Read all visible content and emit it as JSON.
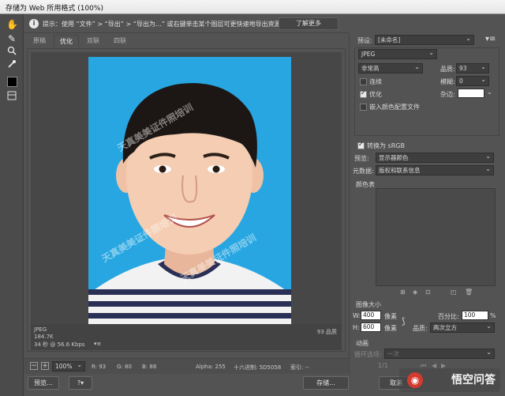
{
  "window": {
    "title": "存储为 Web 所用格式 (100%)"
  },
  "tools": [
    {
      "name": "hand-tool-icon",
      "glyph": "✋"
    },
    {
      "name": "slice-select-tool-icon",
      "glyph": "✎"
    },
    {
      "name": "zoom-tool-icon",
      "glyph": "🔍"
    },
    {
      "name": "eyedropper-tool-icon",
      "glyph": "✒"
    },
    {
      "name": "toggle-slices-icon",
      "glyph": "▤"
    }
  ],
  "tip": {
    "label": "提示：",
    "text": "使用 “文件” > “导出” > “导出为…” 或右键单击某个图层可更快速地导出资源",
    "learn_more": "了解更多"
  },
  "view_tabs": [
    "原稿",
    "优化",
    "双联",
    "四联"
  ],
  "active_tab": "优化",
  "photo": {
    "watermark_text": "天真美美证件照培训",
    "bg_color": "#27a6e1"
  },
  "preview_info": {
    "format": "JPEG",
    "size": "184.7K",
    "time": "34 秒 @ 56.6 Kbps",
    "quality": "93 品质"
  },
  "zoom_bar": {
    "zoom": "100%",
    "r": "R:  93",
    "g": "G:  80",
    "b": "B:  88",
    "alpha": "Alpha: 255",
    "hex": "十六进制: 5D5058",
    "index": "索引: --"
  },
  "buttons": {
    "preview": "预览...",
    "save": "存储...",
    "cancel": "取消"
  },
  "settings": {
    "preset_label": "预设:",
    "preset_value": "[未命名]",
    "format": "JPEG",
    "quality_preset": "非常高",
    "quality_label": "品质:",
    "quality_value": "93",
    "progressive_label": "连续",
    "blur_label": "模糊:",
    "blur_value": "0",
    "optimized_label": "优化",
    "matte_label": "杂边:",
    "embed_profile_label": "嵌入颜色配置文件",
    "progressive_checked": false,
    "optimized_checked": true,
    "embed_profile_checked": false
  },
  "color_settings": {
    "srgb_label": "转换为 sRGB",
    "srgb_checked": true,
    "preview_label": "预览:",
    "preview_value": "显示器颜色",
    "metadata_label": "元数据:",
    "metadata_value": "版权和联系信息"
  },
  "color_table": {
    "title": "颜色表"
  },
  "image_size": {
    "title": "图像大小",
    "w_label": "W:",
    "w_value": "400",
    "h_label": "H:",
    "h_value": "600",
    "unit": "像素",
    "percent_label": "百分比:",
    "percent_value": "100",
    "percent_unit": "%",
    "quality_label": "品质:",
    "quality_value": "两次立方"
  },
  "animation": {
    "title": "动画",
    "loop_label": "循环选项:",
    "loop_value": "一次",
    "frame_counter": "1/1"
  },
  "watermark_logo": {
    "text": "悟空问答"
  }
}
